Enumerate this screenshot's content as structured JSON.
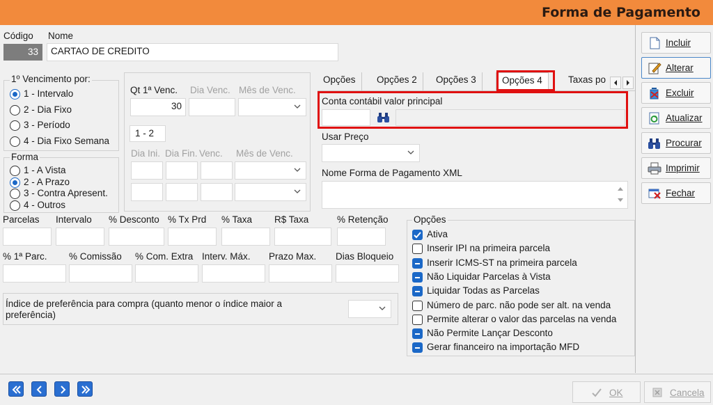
{
  "window": {
    "title": "Forma de Pagamento"
  },
  "header": {
    "codigo_label": "Código",
    "codigo_value": "33",
    "nome_label": "Nome",
    "nome_value": "CARTAO DE CREDITO"
  },
  "vencimento": {
    "label": "1º Vencimento por:",
    "options": [
      "1 - Intervalo",
      "2 - Dia Fixo",
      "3 - Período",
      "4 - Dia Fixo Semana"
    ],
    "selected": "1 - Intervalo"
  },
  "forma": {
    "label": "Forma",
    "options": [
      "1 - A Vista",
      "2 - A Prazo",
      "3 - Contra Apresent.",
      "4 - Outros"
    ],
    "selected": "2 - A Prazo"
  },
  "venc_fields": {
    "qt_label": "Qt 1ª Venc.",
    "qt_value": "30",
    "dia_venc_label": "Dia Venc.",
    "mes_venc_label": "Mês de Venc.",
    "range_value": "1 - 2",
    "dia_ini_label": "Dia Ini.",
    "dia_fin_label": "Dia Fin.",
    "venc_label": "Venc.",
    "mes_venc2_label": "Mês de Venc."
  },
  "grid1": {
    "labels": [
      "Parcelas",
      "Intervalo",
      "% Desconto",
      "% Tx Prd",
      "% Taxa",
      "R$ Taxa",
      "% Retenção"
    ]
  },
  "grid2": {
    "labels": [
      "% 1ª Parc.",
      "% Comissão",
      "% Com. Extra",
      "Interv. Máx.",
      "Prazo Max.",
      "Dias Bloqueio"
    ]
  },
  "preferencia": {
    "label": "Índice de preferência para compra (quanto menor o índice maior a preferência)"
  },
  "tabs": [
    "Opções",
    "Opções 2",
    "Opções 3",
    "Opções 4",
    "Taxas po"
  ],
  "active_tab": "Opções 4",
  "tab4": {
    "conta_label": "Conta contábil valor principal",
    "usar_preco_label": "Usar Preço",
    "nome_xml_label": "Nome Forma de Pagamento XML"
  },
  "opcoes": {
    "label": "Opções",
    "items": [
      {
        "label": "Ativa",
        "state": "checked"
      },
      {
        "label": "Inserir IPI na primeira parcela",
        "state": "unchecked"
      },
      {
        "label": "Inserir ICMS-ST na primeira parcela",
        "state": "indeterminate"
      },
      {
        "label": "Não Liquidar Parcelas à Vista",
        "state": "indeterminate"
      },
      {
        "label": "Liquidar Todas as Parcelas",
        "state": "indeterminate"
      },
      {
        "label": "Número de parc. não pode ser alt. na venda",
        "state": "unchecked"
      },
      {
        "label": "Permite alterar o valor das parcelas na venda",
        "state": "unchecked"
      },
      {
        "label": "Não Permite Lançar Desconto",
        "state": "indeterminate"
      },
      {
        "label": "Gerar financeiro na importação MFD",
        "state": "indeterminate"
      }
    ]
  },
  "side_buttons": [
    "Incluir",
    "Alterar",
    "Excluir",
    "Atualizar",
    "Procurar",
    "Imprimir",
    "Fechar"
  ],
  "footer": {
    "ok_label": "OK",
    "cancel_label": "Cancela"
  },
  "colors": {
    "titlebar": "#f28a3c",
    "highlight": "#e01010",
    "accent": "#1b68c7"
  }
}
